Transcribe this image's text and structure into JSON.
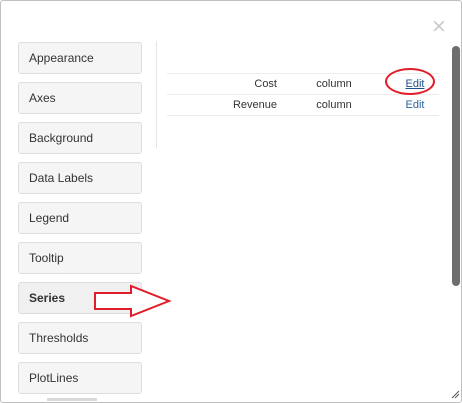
{
  "dialog": {
    "close_label": "×"
  },
  "nav": {
    "items": [
      {
        "label": "Appearance"
      },
      {
        "label": "Axes"
      },
      {
        "label": "Background"
      },
      {
        "label": "Data Labels"
      },
      {
        "label": "Legend"
      },
      {
        "label": "Tooltip"
      },
      {
        "label": "Series",
        "active": true,
        "indicator": ">"
      },
      {
        "label": "Thresholds"
      },
      {
        "label": "PlotLines"
      }
    ]
  },
  "series_table": {
    "rows": [
      {
        "name": "Cost",
        "type": "column",
        "action": "Edit"
      },
      {
        "name": "Revenue",
        "type": "column",
        "action": "Edit"
      }
    ]
  },
  "colors": {
    "annotation_red": "#e11d2a",
    "link_blue": "#2a6496",
    "scrollbar_thumb": "#6e6e6e"
  },
  "icons": {
    "close": "close-icon",
    "resize": "resize-grip-icon",
    "annotation_arrow": "right-arrow-annotation"
  }
}
